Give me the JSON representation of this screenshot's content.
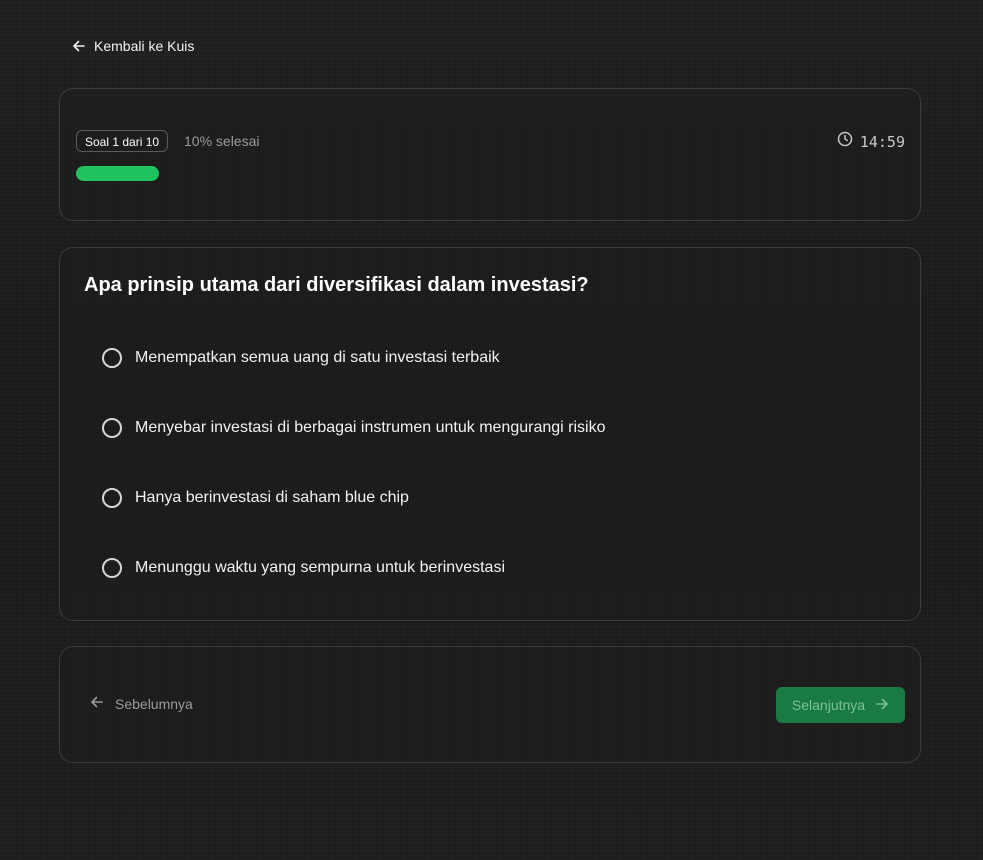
{
  "back_link": {
    "label": "Kembali ke Kuis",
    "icon": "arrow-left-icon"
  },
  "progress": {
    "badge": "Soal 1 dari 10",
    "text": "10% selesai",
    "value_percent": 10,
    "bar_color": "#21c35e",
    "timer_icon": "clock-icon",
    "timer": "14:59"
  },
  "question": {
    "title": "Apa prinsip utama dari diversifikasi dalam investasi?",
    "options": [
      {
        "label": "Menempatkan semua uang di satu investasi terbaik"
      },
      {
        "label": "Menyebar investasi di berbagai instrumen untuk mengurangi risiko"
      },
      {
        "label": "Hanya berinvestasi di saham blue chip"
      },
      {
        "label": "Menunggu waktu yang sempurna untuk berinvestasi"
      }
    ]
  },
  "navigation": {
    "prev_label": "Sebelumnya",
    "prev_icon": "arrow-left-icon",
    "next_label": "Selanjutnya",
    "next_icon": "arrow-right-icon",
    "next_color": "#1a7a43"
  }
}
